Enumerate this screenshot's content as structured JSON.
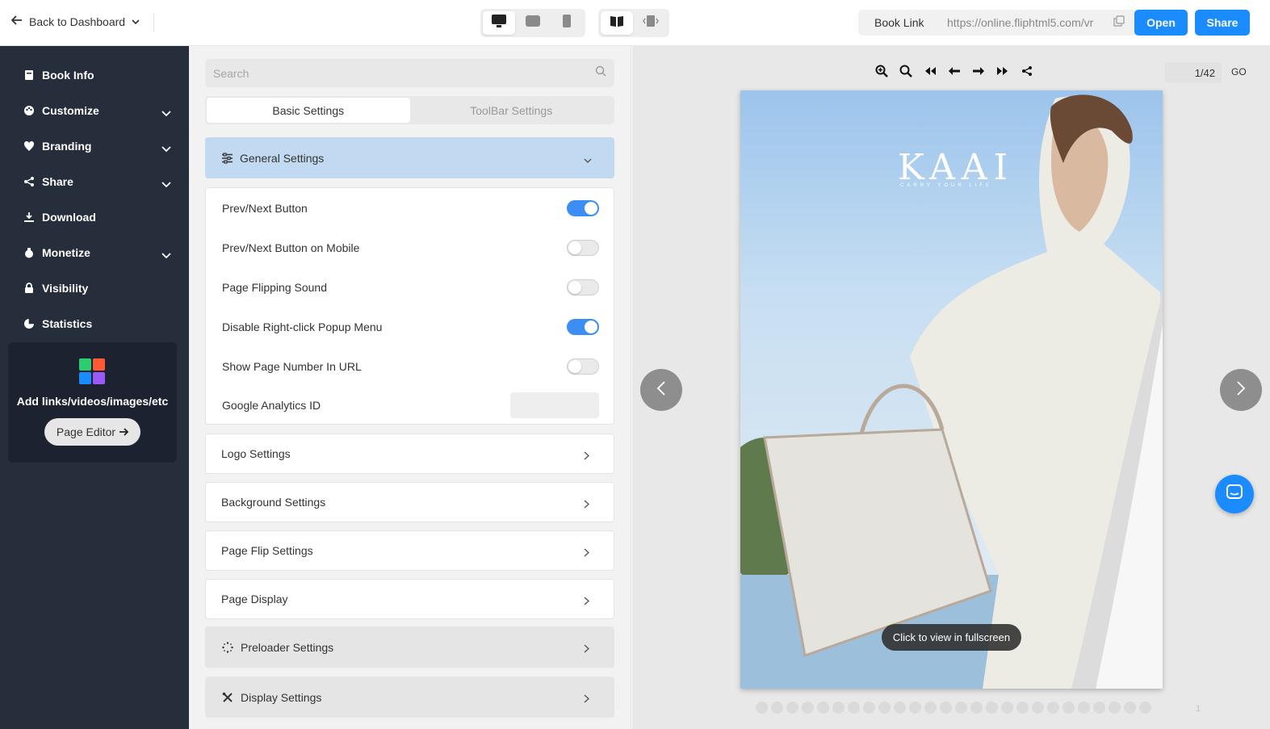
{
  "header": {
    "back_label": "Back to Dashboard",
    "book_link_label": "Book Link",
    "book_link_url": "https://online.fliphtml5.com/vr",
    "open_label": "Open",
    "share_label": "Share",
    "device_modes": [
      "desktop",
      "tablet",
      "mobile"
    ],
    "layout_modes": [
      "double-page",
      "single-page"
    ],
    "active_device": "desktop",
    "active_layout": "double-page"
  },
  "sidebar": {
    "items": [
      {
        "label": "Book Info",
        "icon": "book-icon",
        "has_caret": false
      },
      {
        "label": "Customize",
        "icon": "palette-icon",
        "has_caret": true
      },
      {
        "label": "Branding",
        "icon": "tag-icon",
        "has_caret": true
      },
      {
        "label": "Share",
        "icon": "share-icon",
        "has_caret": true
      },
      {
        "label": "Download",
        "icon": "download-icon",
        "has_caret": false
      },
      {
        "label": "Monetize",
        "icon": "money-bag-icon",
        "has_caret": true
      },
      {
        "label": "Visibility",
        "icon": "lock-icon",
        "has_caret": false
      },
      {
        "label": "Statistics",
        "icon": "pie-chart-icon",
        "has_caret": false
      }
    ],
    "promo": {
      "text": "Add links/videos/images/etc",
      "button_label": "Page Editor"
    }
  },
  "settings": {
    "search_placeholder": "Search",
    "tabs": [
      {
        "label": "Basic Settings",
        "active": true
      },
      {
        "label": "ToolBar Settings",
        "active": false
      }
    ],
    "general_title": "General Settings",
    "general_rows": [
      {
        "label": "Prev/Next Button",
        "on": true
      },
      {
        "label": "Prev/Next Button on Mobile",
        "on": false
      },
      {
        "label": "Page Flipping Sound",
        "on": false
      },
      {
        "label": "Disable Right-click Popup Menu",
        "on": true
      },
      {
        "label": "Show Page Number In URL",
        "on": false
      }
    ],
    "ga_label": "Google Analytics ID",
    "ga_value": "",
    "sections": [
      "Logo Settings",
      "Background Settings",
      "Page Flip Settings",
      "Page Display"
    ],
    "grey_sections": [
      {
        "label": "Preloader Settings",
        "icon": "spinner-icon"
      },
      {
        "label": "Display Settings",
        "icon": "tools-icon"
      }
    ]
  },
  "preview": {
    "page_indicator": "1/42",
    "go_label": "GO",
    "brand_logo": "KAAI",
    "brand_tagline": "CARRY YOUR LIFE",
    "fullscreen_label": "Click to view in fullscreen",
    "thumb_page_number": "1",
    "toolbar_icons": [
      "zoom-in-icon",
      "zoom-out-icon",
      "first-page-icon",
      "prev-page-icon",
      "next-page-icon",
      "last-page-icon",
      "share-icon"
    ]
  },
  "colors": {
    "accent": "#1a8cff",
    "sidebar_bg": "#262d3b",
    "general_header_bg": "#c2daf1",
    "toggle_on": "#3d8ef2"
  }
}
